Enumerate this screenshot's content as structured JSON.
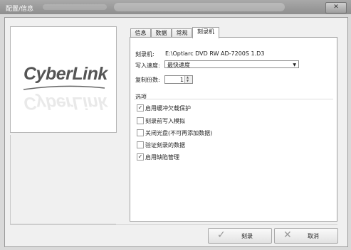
{
  "window": {
    "title": "配置/信息",
    "close_glyph": "✕"
  },
  "logo": {
    "text": "CyberLink"
  },
  "tabs": [
    {
      "label": "信息"
    },
    {
      "label": "数据"
    },
    {
      "label": "常规"
    },
    {
      "label": "刻录机"
    }
  ],
  "burner": {
    "recorder_label": "刻录机:",
    "recorder_value": "E:\\Optiarc DVD RW AD-7200S 1.D3",
    "speed_label": "写入速度:",
    "speed_value": "最快速度",
    "copies_label": "复制份数:",
    "copies_value": "1"
  },
  "options": {
    "header": "选项",
    "items": [
      {
        "label": "启用缓冲欠载保护",
        "checked": true
      },
      {
        "label": "刻录前写入模拟",
        "checked": false
      },
      {
        "label": "关闭光盘(不可再添加数据)",
        "checked": false
      },
      {
        "label": "验证刻录的数据",
        "checked": false
      },
      {
        "label": "启用缺陷管理",
        "checked": true
      }
    ]
  },
  "buttons": {
    "burn_label": "刻录",
    "cancel_label": "取消"
  }
}
